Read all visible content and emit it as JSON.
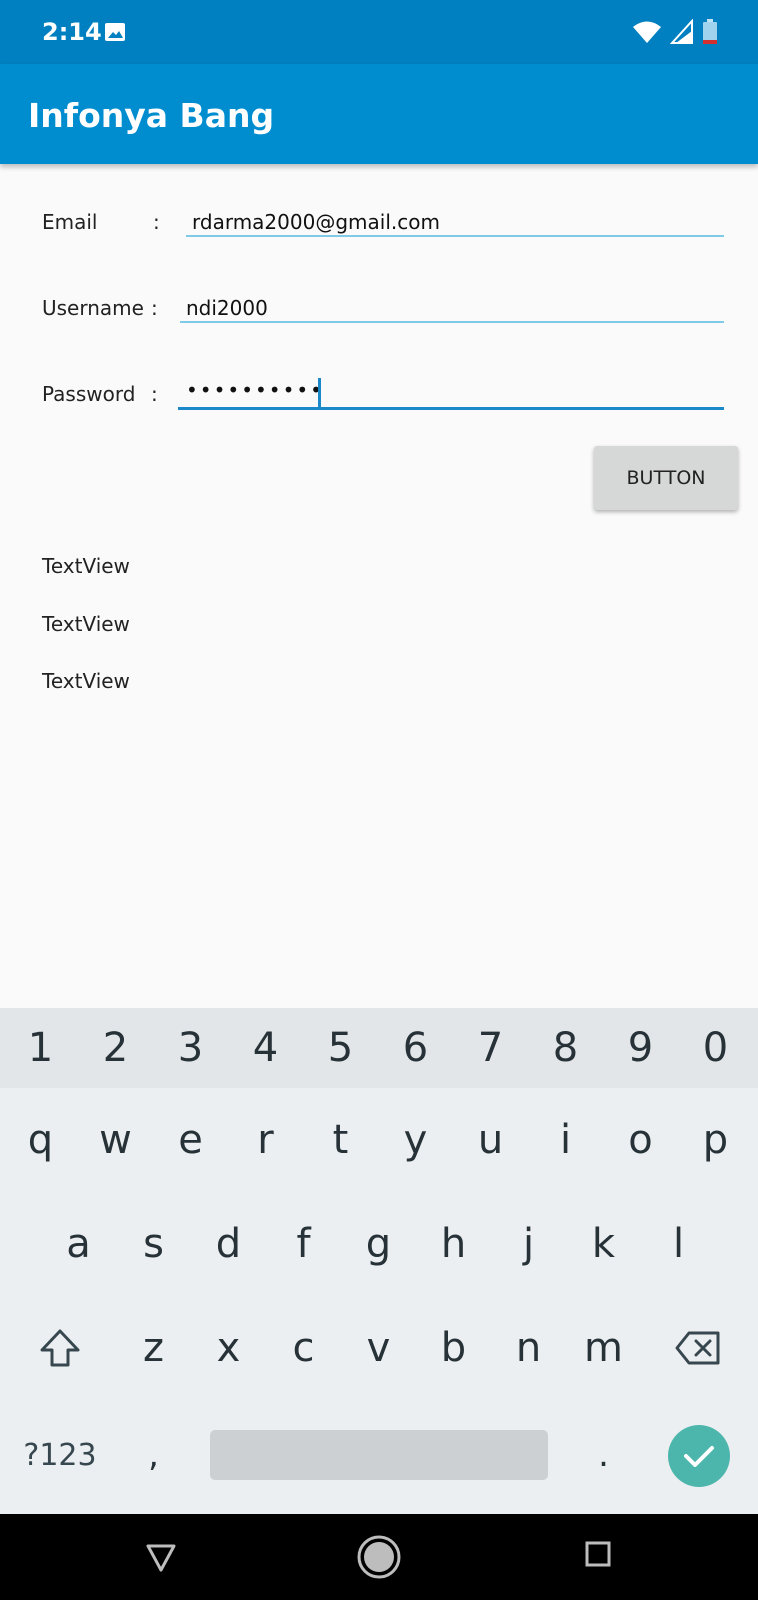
{
  "status_bar": {
    "time": "2:14"
  },
  "app_bar": {
    "title": "Infonya Bang"
  },
  "form": {
    "email": {
      "label": "Email",
      "colon": ":",
      "value": "rdarma2000@gmail.com"
    },
    "username": {
      "label": "Username",
      "colon": ":",
      "value": "ndi2000"
    },
    "password": {
      "label": "Password",
      "colon": ":",
      "masked_value": "••••••••••"
    }
  },
  "button": {
    "label": "BUTTON"
  },
  "textviews": [
    "TextView",
    "TextView",
    "TextView"
  ],
  "keyboard": {
    "numbers": [
      "1",
      "2",
      "3",
      "4",
      "5",
      "6",
      "7",
      "8",
      "9",
      "0"
    ],
    "row1": [
      "q",
      "w",
      "e",
      "r",
      "t",
      "y",
      "u",
      "i",
      "o",
      "p"
    ],
    "row2": [
      "a",
      "s",
      "d",
      "f",
      "g",
      "h",
      "j",
      "k",
      "l"
    ],
    "row3": [
      "z",
      "x",
      "c",
      "v",
      "b",
      "n",
      "m"
    ],
    "symbols_label": "?123",
    "comma": ",",
    "period": "."
  },
  "colors": {
    "status_bar": "#0080c0",
    "app_bar": "#008dd0",
    "accent": "#1a88c9",
    "enter_key": "#4db6ac"
  }
}
